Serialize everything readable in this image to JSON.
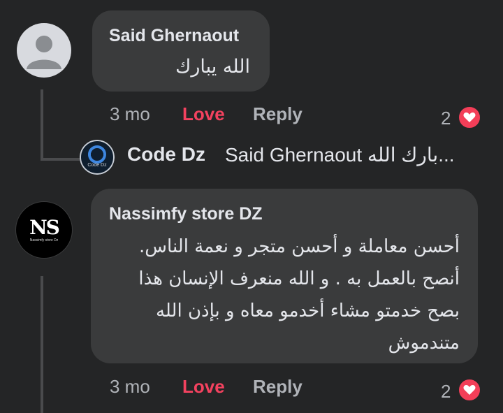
{
  "comments": [
    {
      "author": "Said Ghernaout",
      "text": "الله يبارك",
      "time": "3 mo",
      "love_label": "Love",
      "reply_label": "Reply",
      "reaction_count": "2",
      "avatar_icon": "default-user-icon"
    },
    {
      "author": "Nassimfy store DZ",
      "avatar_text": "NS",
      "avatar_subtext": "Nassimfy store Dz",
      "text_lines": [
        "أحسن معاملة و أحسن متجر و نعمة الناس.",
        "أنصح بالعمل به . و الله منعرف الإنسان هذا",
        "بصح خدمتو مشاء أخدمو معاه و بإذن الله",
        "متندموش"
      ],
      "time": "3 mo",
      "love_label": "Love",
      "reply_label": "Reply",
      "reaction_count": "2"
    }
  ],
  "reply": {
    "author": "Code Dz",
    "avatar_label": "Code Dz",
    "text": "Said Ghernaout بارك الله..."
  },
  "colors": {
    "background": "#242526",
    "bubble": "#3a3b3c",
    "love": "#f3425f",
    "heart": "#f33e58"
  }
}
